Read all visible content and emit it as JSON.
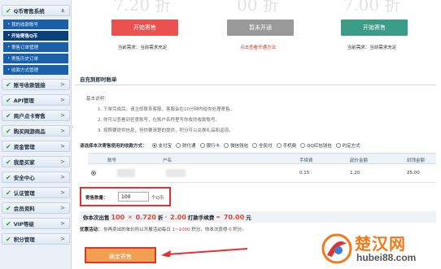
{
  "sidebar": {
    "items": [
      {
        "label": "Q币寄售系统",
        "arrow": "∧"
      },
      {
        "label": "账号收款链接",
        "arrow": ">"
      },
      {
        "label": "API管理",
        "arrow": ">"
      },
      {
        "label": "商户点卡寄售",
        "arrow": ">"
      },
      {
        "label": "购买网游商品",
        "arrow": ">"
      },
      {
        "label": "资金管理",
        "arrow": ">"
      },
      {
        "label": "我是买家",
        "arrow": ">"
      },
      {
        "label": "安全中心",
        "arrow": ">"
      },
      {
        "label": "认证管理",
        "arrow": ">"
      },
      {
        "label": "会员资料",
        "arrow": ">"
      },
      {
        "label": "VIP等级",
        "arrow": ">"
      },
      {
        "label": "积分管理",
        "arrow": ">"
      }
    ],
    "sub_items": [
      {
        "label": "我的收款账号"
      },
      {
        "label": "开始寄售Q币"
      },
      {
        "label": "寄售订单管理"
      },
      {
        "label": "寄售历史订单"
      },
      {
        "label": "收款方式管理"
      }
    ],
    "collapse_glyph": "‹"
  },
  "cards": [
    {
      "big": "7.20 折",
      "button": "开始寄售",
      "note": "当前需求：当前需求充足"
    },
    {
      "big": "00 折",
      "button": "暂未开通",
      "note": "点击查看开通方法"
    },
    {
      "big": "7.00 折",
      "button": "开始寄售",
      "note": "当前需求：当前需求充足"
    }
  ],
  "section": {
    "tab": "自充到即时账单"
  },
  "desc": {
    "title": "基本说明：",
    "lines": [
      "1. 下单完成后，请立即联系客服，客服会在10分钟内给你处理寄售。",
      "2. 你可以查看到任意账号，在账户名称里写你收的收款账号。",
      "3. 按照要提供信息，但你要清楚的提供，积分可以兑换礼品和返现。"
    ]
  },
  "paymethod": {
    "label": "请选择本次寄售使用的收款方式：",
    "options": [
      "支付宝",
      "财付通",
      "银行卡",
      "微信钱包",
      "全民付",
      "手机费",
      "QQ红包钱包",
      "约定方式"
    ],
    "selected": 0
  },
  "table": {
    "headers": [
      "账号",
      "户名",
      "手续费",
      "起价金额",
      "封顶金额"
    ],
    "rows": [
      {
        "fee": "0.15",
        "min": "1.20",
        "max": "25.00"
      }
    ]
  },
  "qty": {
    "label": "寄售数量：",
    "value": "100",
    "unit": "个Q币"
  },
  "formula": {
    "prefix": "你本次出售",
    "qty": "100",
    "times": "×",
    "rate": "0.720",
    "rate_unit": "折",
    "minus": "-",
    "fee": "2.00",
    "fee_text": "打款手续费",
    "equals": "=",
    "total": "70.00",
    "currency": "元"
  },
  "promo": {
    "label": "优惠活动：",
    "text": "你再卖出的单价所以开展活动每日",
    "range": "1~1000",
    "suffix": "积分，你本次获得",
    "points": "0",
    "points_unit": "积分。"
  },
  "confirm_button": "确定寄售",
  "watermark": {
    "text": "楚汉网",
    "url": "hubei88.com"
  },
  "colors": {
    "primary_button": "#e9524f",
    "disabled_button": "#999999",
    "secondary_button": "#3b9c87",
    "confirm_button": "#f0a050",
    "highlight": "#e0332f",
    "sidebar_active": "#0b3f7a",
    "sidebar_sub": "#1a5fa8"
  }
}
